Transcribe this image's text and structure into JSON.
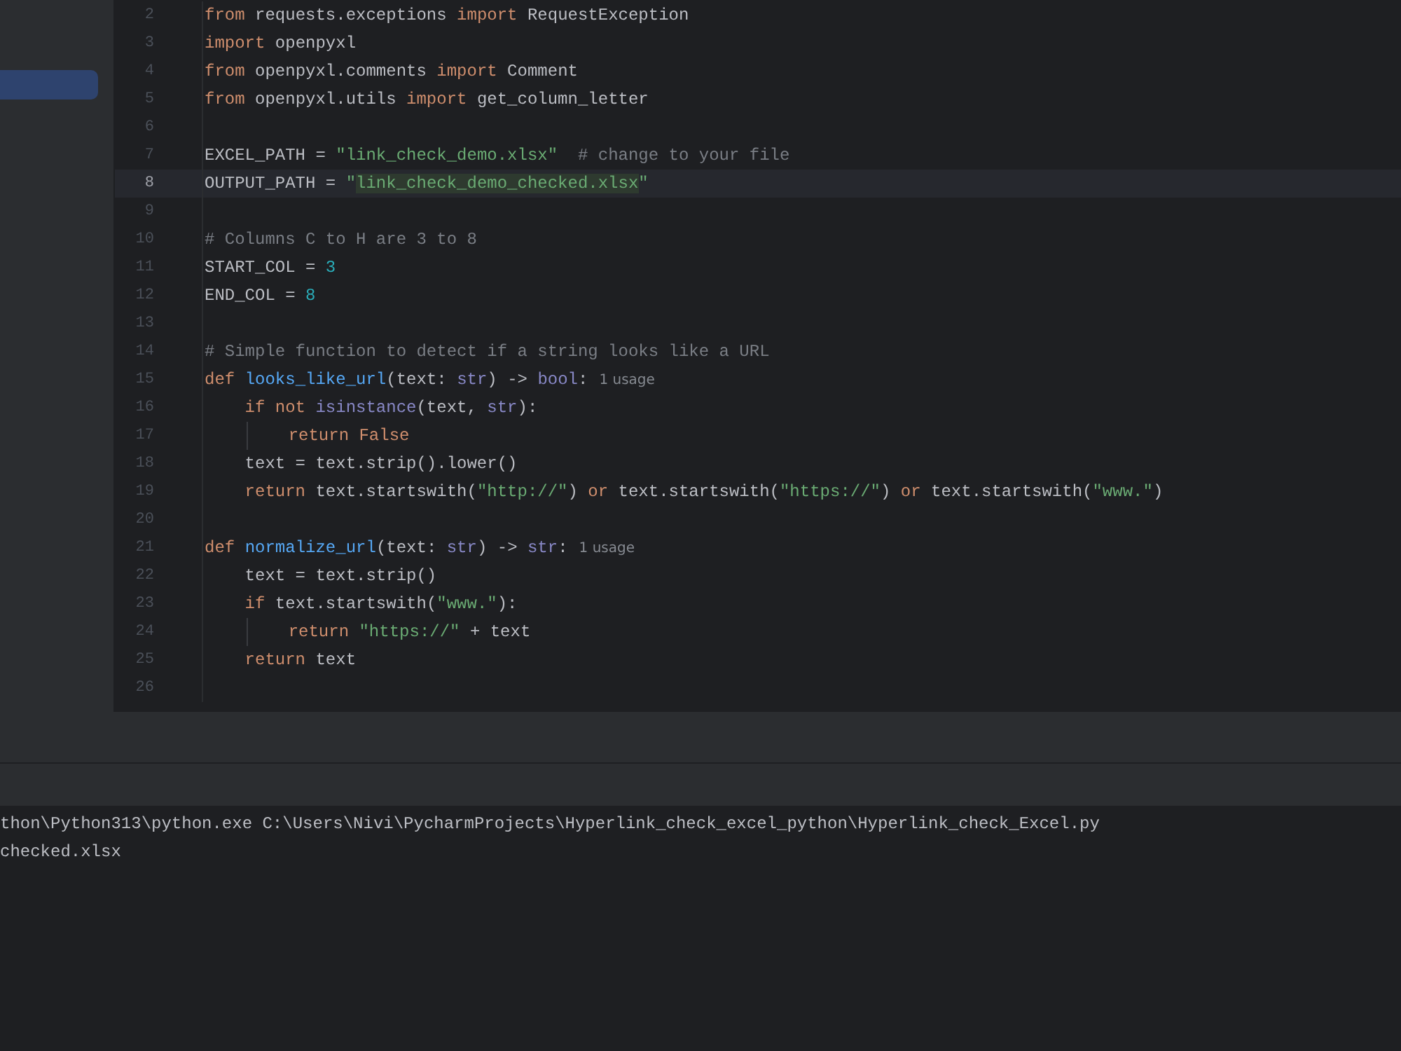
{
  "sidebar": {
    "items": [
      {
        "selected": true
      }
    ]
  },
  "editor": {
    "lines": [
      {
        "n": "2",
        "current": false,
        "guide": false,
        "tokens": [
          {
            "kind": "kw",
            "text": "from"
          },
          {
            "kind": "plain",
            "text": " requests.exceptions "
          },
          {
            "kind": "kw",
            "text": "import"
          },
          {
            "kind": "plain",
            "text": " RequestException"
          }
        ]
      },
      {
        "n": "3",
        "current": false,
        "guide": false,
        "tokens": [
          {
            "kind": "kw",
            "text": "import"
          },
          {
            "kind": "plain",
            "text": " openpyxl"
          }
        ]
      },
      {
        "n": "4",
        "current": false,
        "guide": false,
        "tokens": [
          {
            "kind": "kw",
            "text": "from"
          },
          {
            "kind": "plain",
            "text": " openpyxl.comments "
          },
          {
            "kind": "kw",
            "text": "import"
          },
          {
            "kind": "plain",
            "text": " Comment"
          }
        ]
      },
      {
        "n": "5",
        "current": false,
        "guide": false,
        "tokens": [
          {
            "kind": "kw",
            "text": "from"
          },
          {
            "kind": "plain",
            "text": " openpyxl.utils "
          },
          {
            "kind": "kw",
            "text": "import"
          },
          {
            "kind": "plain",
            "text": " get_column_letter"
          }
        ]
      },
      {
        "n": "6",
        "current": false,
        "guide": false
      },
      {
        "n": "7",
        "current": false,
        "guide": false,
        "tokens": [
          {
            "kind": "plain",
            "text": "EXCEL_PATH = "
          },
          {
            "kind": "str",
            "text": "\"link_check_demo.xlsx\""
          },
          {
            "kind": "comment",
            "text": "  # change to your file"
          }
        ]
      },
      {
        "n": "8",
        "current": true,
        "guide": false,
        "tokens": [
          {
            "kind": "plain",
            "text": "OUTPUT_PATH = "
          },
          {
            "kind": "str",
            "text": "\""
          },
          {
            "kind": "match",
            "text": "link_check_demo_checked.xlsx"
          },
          {
            "kind": "str",
            "text": "\""
          }
        ]
      },
      {
        "n": "9",
        "current": false,
        "guide": false
      },
      {
        "n": "10",
        "current": false,
        "guide": false,
        "tokens": [
          {
            "kind": "comment",
            "text": "# Columns C to H are 3 to 8"
          }
        ]
      },
      {
        "n": "11",
        "current": false,
        "guide": false,
        "tokens": [
          {
            "kind": "plain",
            "text": "START_COL = "
          },
          {
            "kind": "num",
            "text": "3"
          }
        ]
      },
      {
        "n": "12",
        "current": false,
        "guide": false,
        "tokens": [
          {
            "kind": "plain",
            "text": "END_COL = "
          },
          {
            "kind": "num",
            "text": "8"
          }
        ]
      },
      {
        "n": "13",
        "current": false,
        "guide": false
      },
      {
        "n": "14",
        "current": false,
        "guide": false,
        "tokens": [
          {
            "kind": "comment",
            "text": "# Simple function to detect if a string looks like a URL"
          }
        ]
      },
      {
        "n": "15",
        "current": false,
        "guide": false,
        "tokens": [
          {
            "kind": "kw",
            "text": "def "
          },
          {
            "kind": "fn",
            "text": "looks_like_url"
          },
          {
            "kind": "plain",
            "text": "(text: "
          },
          {
            "kind": "builtin",
            "text": "str"
          },
          {
            "kind": "plain",
            "text": ") -> "
          },
          {
            "kind": "builtin",
            "text": "bool"
          },
          {
            "kind": "plain",
            "text": ":"
          },
          {
            "kind": "hint",
            "text": "1 usage"
          }
        ]
      },
      {
        "n": "16",
        "current": false,
        "guide": false,
        "tokens": [
          {
            "kind": "kw",
            "text": "    if not "
          },
          {
            "kind": "builtin",
            "text": "isinstance"
          },
          {
            "kind": "plain",
            "text": "(text, "
          },
          {
            "kind": "builtin",
            "text": "str"
          },
          {
            "kind": "plain",
            "text": "):"
          }
        ]
      },
      {
        "n": "17",
        "current": false,
        "guide": true,
        "tokens": [
          {
            "kind": "kw",
            "text": "return False"
          }
        ]
      },
      {
        "n": "18",
        "current": false,
        "guide": false,
        "tokens": [
          {
            "kind": "plain",
            "text": "    text = text.strip().lower()"
          }
        ]
      },
      {
        "n": "19",
        "current": false,
        "guide": false,
        "tokens": [
          {
            "kind": "kw",
            "text": "    return"
          },
          {
            "kind": "plain",
            "text": " text.startswith("
          },
          {
            "kind": "str",
            "text": "\"http://\""
          },
          {
            "kind": "plain",
            "text": ") "
          },
          {
            "kind": "kw",
            "text": "or"
          },
          {
            "kind": "plain",
            "text": " text.startswith("
          },
          {
            "kind": "str",
            "text": "\"https://\""
          },
          {
            "kind": "plain",
            "text": ") "
          },
          {
            "kind": "kw",
            "text": "or"
          },
          {
            "kind": "plain",
            "text": " text.startswith("
          },
          {
            "kind": "str",
            "text": "\"www.\""
          },
          {
            "kind": "plain",
            "text": ")"
          }
        ]
      },
      {
        "n": "20",
        "current": false,
        "guide": false
      },
      {
        "n": "21",
        "current": false,
        "guide": false,
        "tokens": [
          {
            "kind": "kw",
            "text": "def "
          },
          {
            "kind": "fn",
            "text": "normalize_url"
          },
          {
            "kind": "plain",
            "text": "(text: "
          },
          {
            "kind": "builtin",
            "text": "str"
          },
          {
            "kind": "plain",
            "text": ") -> "
          },
          {
            "kind": "builtin",
            "text": "str"
          },
          {
            "kind": "plain",
            "text": ":"
          },
          {
            "kind": "hint",
            "text": "1 usage"
          }
        ]
      },
      {
        "n": "22",
        "current": false,
        "guide": false,
        "tokens": [
          {
            "kind": "plain",
            "text": "    text = text.strip()"
          }
        ]
      },
      {
        "n": "23",
        "current": false,
        "guide": false,
        "tokens": [
          {
            "kind": "kw",
            "text": "    if"
          },
          {
            "kind": "plain",
            "text": " text.startswith("
          },
          {
            "kind": "str",
            "text": "\"www.\""
          },
          {
            "kind": "plain",
            "text": "):"
          }
        ]
      },
      {
        "n": "24",
        "current": false,
        "guide": true,
        "tokens": [
          {
            "kind": "kw",
            "text": "return "
          },
          {
            "kind": "str",
            "text": "\"https://\""
          },
          {
            "kind": "plain",
            "text": " + text"
          }
        ]
      },
      {
        "n": "25",
        "current": false,
        "guide": false,
        "tokens": [
          {
            "kind": "kw",
            "text": "    return"
          },
          {
            "kind": "plain",
            "text": " text"
          }
        ]
      },
      {
        "n": "26",
        "current": false,
        "guide": false
      }
    ]
  },
  "console": {
    "lines": [
      "thon\\Python313\\python.exe C:\\Users\\Nivi\\PycharmProjects\\Hyperlink_check_excel_python\\Hyperlink_check_Excel.py",
      "checked.xlsx"
    ]
  }
}
